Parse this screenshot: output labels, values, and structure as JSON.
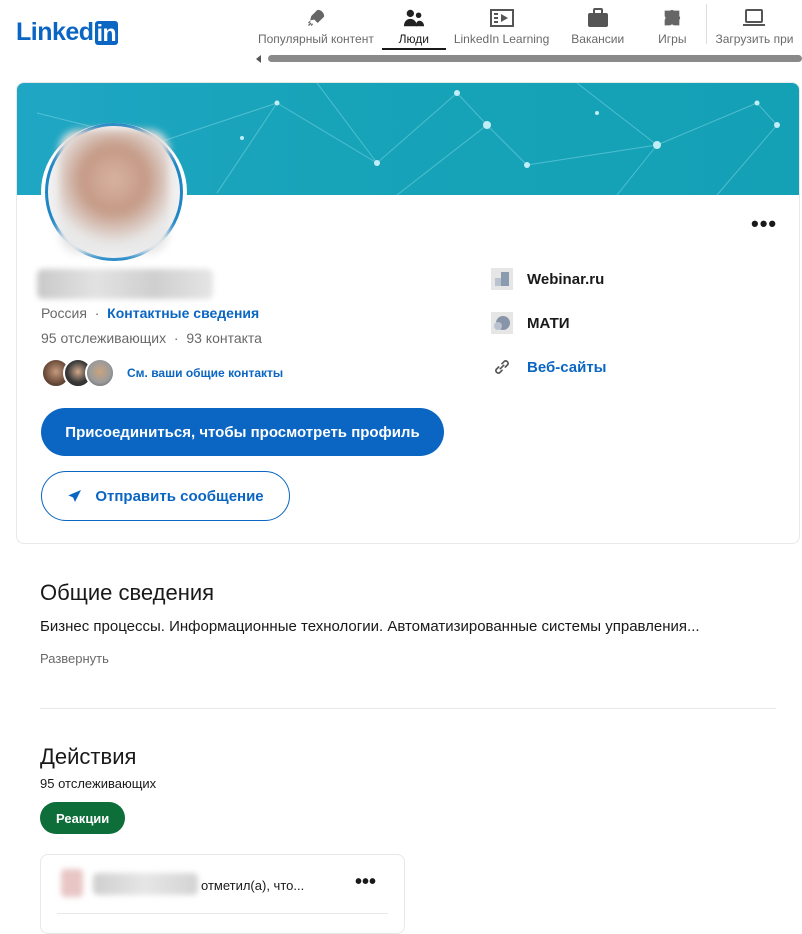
{
  "logo": {
    "text": "Linked",
    "in": "in"
  },
  "nav": {
    "items": [
      {
        "label": "Популярный контент",
        "icon": "rocket-icon"
      },
      {
        "label": "Люди",
        "icon": "people-icon",
        "active": true
      },
      {
        "label": "LinkedIn Learning",
        "icon": "video-icon"
      },
      {
        "label": "Вакансии",
        "icon": "briefcase-icon"
      },
      {
        "label": "Игры",
        "icon": "puzzle-icon"
      },
      {
        "label": "Загрузить при",
        "icon": "laptop-icon"
      }
    ]
  },
  "profile": {
    "location": "Россия",
    "dot": "·",
    "contact_link": "Контактные сведения",
    "followers": "95 отслеживающих",
    "contacts": "93 контакта",
    "mutual_link": "См. ваши общие контакты",
    "more_label": "•••",
    "join_button": "Присоединиться, чтобы просмотреть профиль",
    "message_button": "Отправить сообщение",
    "right": {
      "company": "Webinar.ru",
      "school": "МАТИ",
      "websites": "Веб-сайты"
    }
  },
  "about": {
    "title": "Общие сведения",
    "text": "Бизнес процессы. Информационные технологии. Автоматизированные системы управления...",
    "expand": "Развернуть"
  },
  "activity": {
    "title": "Действия",
    "followers": "95 отслеживающих",
    "reactions_pill": "Реакции",
    "post": {
      "text": "отметил(а), что...",
      "more": "•••"
    }
  },
  "colors": {
    "brand": "#0a66c2",
    "reactions": "#0d6e3a",
    "banner": "#17a3b8"
  }
}
